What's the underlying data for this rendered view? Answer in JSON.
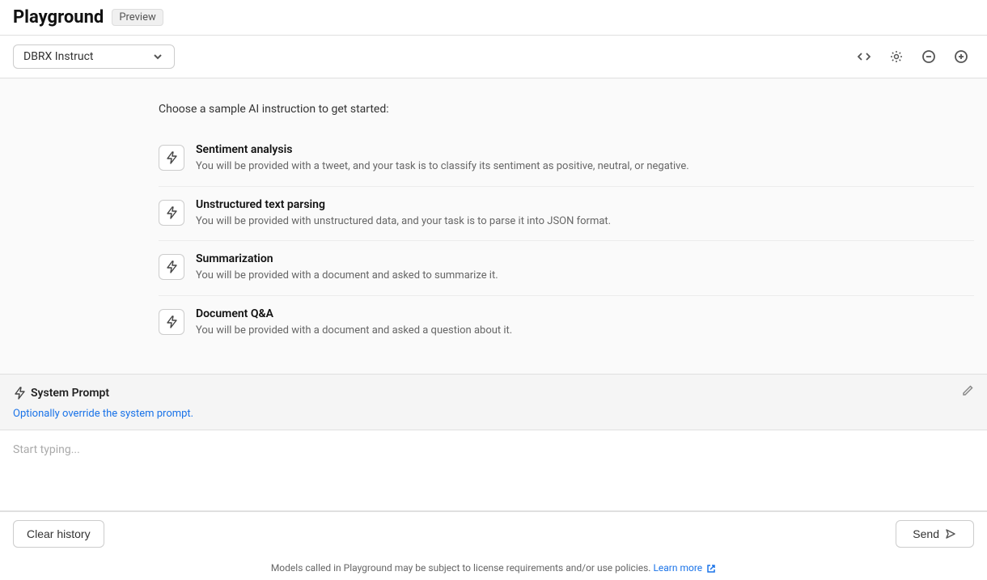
{
  "header": {
    "title": "Playground",
    "badge": "Preview"
  },
  "toolbar": {
    "model_label": "DBRX Instruct",
    "icons": [
      "code-icon",
      "settings-icon",
      "minus-icon",
      "plus-icon"
    ]
  },
  "main": {
    "choose_text": "Choose a sample AI instruction to get started:",
    "samples": [
      {
        "title": "Sentiment analysis",
        "description": "You will be provided with a tweet, and your task is to classify its sentiment as positive, neutral, or negative."
      },
      {
        "title": "Unstructured text parsing",
        "description": "You will be provided with unstructured data, and your task is to parse it into JSON format."
      },
      {
        "title": "Summarization",
        "description": "You will be provided with a document and asked to summarize it."
      },
      {
        "title": "Document Q&A",
        "description": "You will be provided with a document and asked a question about it."
      }
    ]
  },
  "system_prompt": {
    "label": "System Prompt",
    "placeholder": "Optionally override the system prompt."
  },
  "chat": {
    "placeholder": "Start typing..."
  },
  "buttons": {
    "clear_history": "Clear history",
    "send": "Send"
  },
  "footer": {
    "notice": "Models called in Playground may be subject to license requirements and/or use policies.",
    "learn_more": "Learn more"
  }
}
